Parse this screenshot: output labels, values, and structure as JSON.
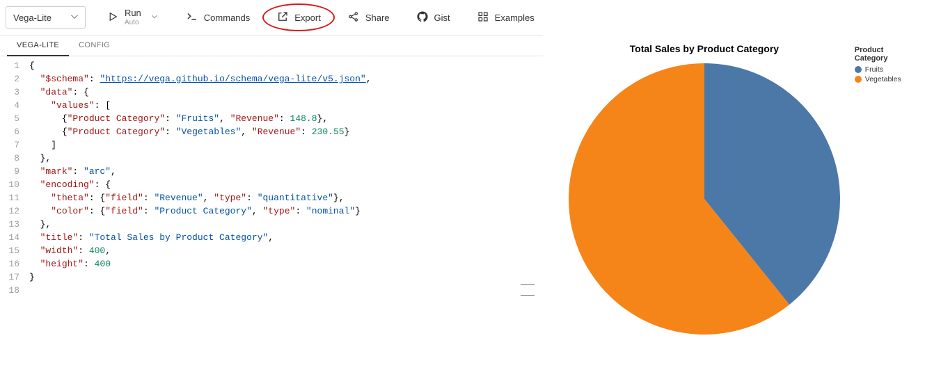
{
  "toolbar": {
    "mode_label": "Vega-Lite",
    "run_label": "Run",
    "run_sub": "Auto",
    "commands_label": "Commands",
    "export_label": "Export",
    "share_label": "Share",
    "gist_label": "Gist",
    "examples_label": "Examples"
  },
  "tabs": {
    "vega_lite": "VEGA-LITE",
    "config": "CONFIG"
  },
  "editor": {
    "line_count": 18,
    "spec": {
      "schema_key": "\"$schema\"",
      "schema_val": "\"https://vega.github.io/schema/vega-lite/v5.json\"",
      "data_key": "\"data\"",
      "values_key": "\"values\"",
      "row1_pc_key": "\"Product Category\"",
      "row1_pc_val": "\"Fruits\"",
      "row1_rev_key": "\"Revenue\"",
      "row1_rev_val": "148.8",
      "row2_pc_key": "\"Product Category\"",
      "row2_pc_val": "\"Vegetables\"",
      "row2_rev_key": "\"Revenue\"",
      "row2_rev_val": "230.55",
      "mark_key": "\"mark\"",
      "mark_val": "\"arc\"",
      "encoding_key": "\"encoding\"",
      "theta_key": "\"theta\"",
      "field_key": "\"field\"",
      "theta_field_val": "\"Revenue\"",
      "type_key": "\"type\"",
      "theta_type_val": "\"quantitative\"",
      "color_key": "\"color\"",
      "color_field_val": "\"Product Category\"",
      "color_type_val": "\"nominal\"",
      "title_key": "\"title\"",
      "title_val": "\"Total Sales by Product Category\"",
      "width_key": "\"width\"",
      "width_val": "400",
      "height_key": "\"height\"",
      "height_val": "400"
    }
  },
  "chart_data": {
    "type": "pie",
    "title": "Total Sales by Product Category",
    "legend_title": "Product Category",
    "series": [
      {
        "name": "Fruits",
        "value": 148.8,
        "color": "#4c78a8"
      },
      {
        "name": "Vegetables",
        "value": 230.55,
        "color": "#f58518"
      }
    ]
  }
}
